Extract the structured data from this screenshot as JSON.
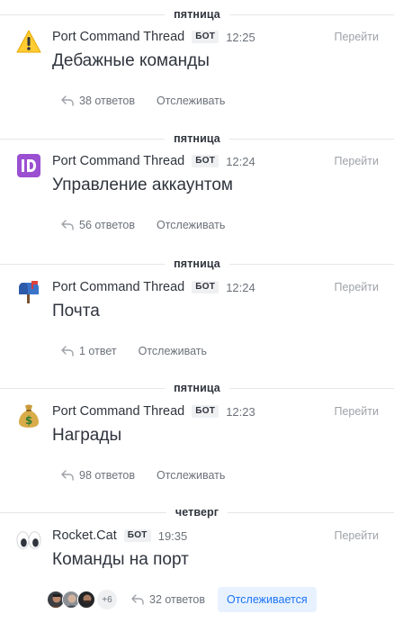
{
  "feed": {
    "threads": [
      {
        "day": "пятница",
        "author": "Port Command Thread",
        "badge": "БОТ",
        "time": "12:25",
        "goto": "Перейти",
        "text": "Дебажные команды",
        "replies": "38 ответов",
        "follow": "Отслеживать",
        "avatar_icon": "warning-emoji-icon"
      },
      {
        "day": "пятница",
        "author": "Port Command Thread",
        "badge": "БОТ",
        "time": "12:24",
        "goto": "Перейти",
        "text": "Управление аккаунтом",
        "replies": "56 ответов",
        "follow": "Отслеживать",
        "avatar_icon": "id-emoji-icon"
      },
      {
        "day": "пятница",
        "author": "Port Command Thread",
        "badge": "БОТ",
        "time": "12:24",
        "goto": "Перейти",
        "text": "Почта",
        "replies": "1 ответ",
        "follow": "Отслеживать",
        "avatar_icon": "mailbox-emoji-icon"
      },
      {
        "day": "пятница",
        "author": "Port Command Thread",
        "badge": "БОТ",
        "time": "12:23",
        "goto": "Перейти",
        "text": "Награды",
        "replies": "98 ответов",
        "follow": "Отслеживать",
        "avatar_icon": "money-bag-emoji-icon"
      },
      {
        "day": "четверг",
        "author": "Rocket.Cat",
        "badge": "БОТ",
        "time": "19:35",
        "goto": "Перейти",
        "text": "Команды на порт",
        "replies": "32 ответов",
        "follow": "Отслеживается",
        "avatar_icon": "eyes-emoji-icon",
        "participants_more": "+6"
      }
    ]
  },
  "colors": {
    "text": "#2f343d",
    "muted": "#6c727a",
    "faint": "#9ea2a8",
    "accent": "#1d74f5",
    "accent_bg": "#e8f2ff",
    "divider": "#e4e7ea"
  }
}
